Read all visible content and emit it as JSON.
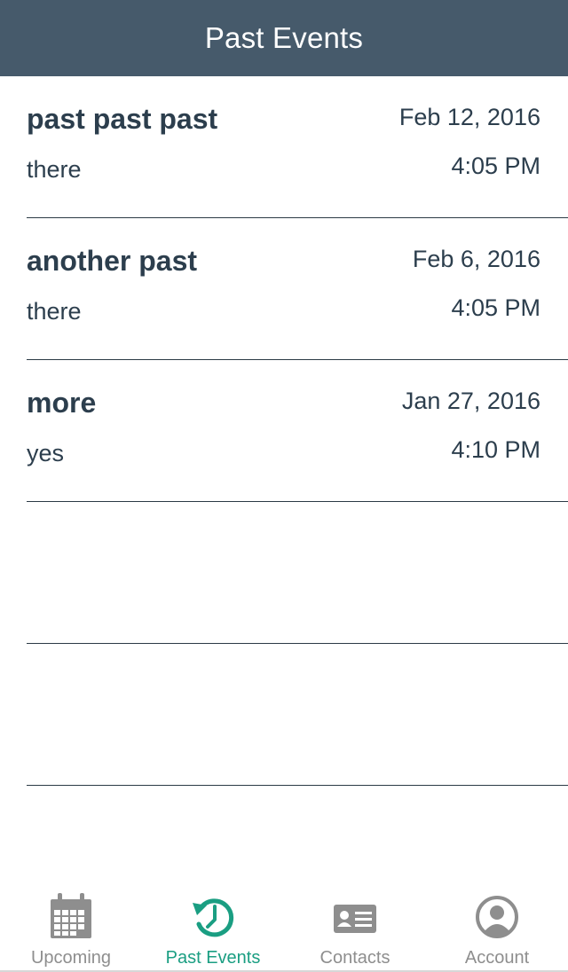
{
  "header": {
    "title": "Past Events"
  },
  "events": [
    {
      "name": "past past past",
      "location": "there",
      "date": "Feb 12, 2016",
      "time": "4:05 PM"
    },
    {
      "name": "another past",
      "location": "there",
      "date": "Feb 6, 2016",
      "time": "4:05 PM"
    },
    {
      "name": "more",
      "location": "yes",
      "date": "Jan 27, 2016",
      "time": "4:10 PM"
    }
  ],
  "tabs": [
    {
      "label": "Upcoming",
      "icon": "calendar-icon",
      "active": false
    },
    {
      "label": "Past Events",
      "icon": "history-icon",
      "active": true
    },
    {
      "label": "Contacts",
      "icon": "contact-card-icon",
      "active": false
    },
    {
      "label": "Account",
      "icon": "account-icon",
      "active": false
    }
  ],
  "colors": {
    "header_bg": "#465a6b",
    "accent": "#1a9e82",
    "inactive_tab": "#8e8e8e",
    "text": "#2c3e4d"
  }
}
